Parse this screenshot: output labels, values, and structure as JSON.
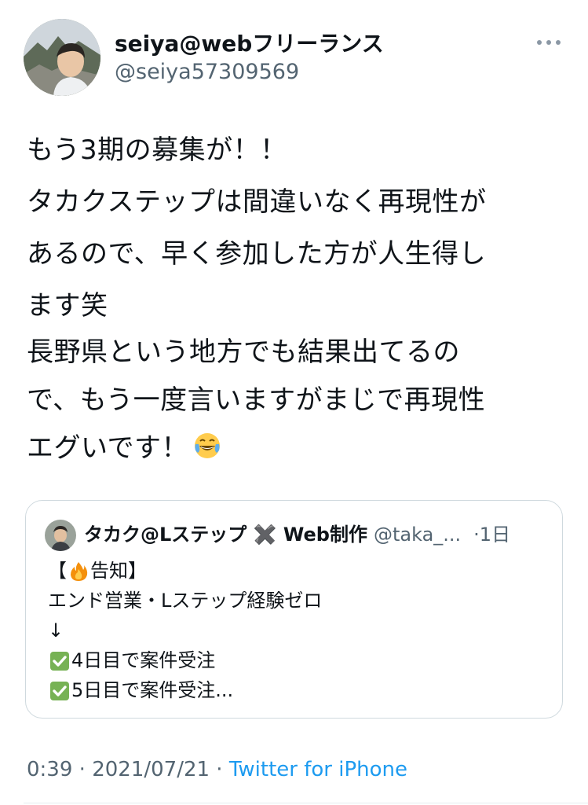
{
  "author": {
    "display_name": "seiya@webフリーランス",
    "handle": "@seiya57309569"
  },
  "tweet": {
    "paragraph1": "もう3期の募集が！！\nタカクステップは間違いなく再現性が\nあるので、早く参加した方が人生得し\nます笑",
    "paragraph2": "長野県という地方でも結果出てるの\nで、もう一度言いますがまじで再現性\nエグいです！",
    "emoji_icon": "face-with-tears-of-joy"
  },
  "quote": {
    "display_name": "タカク@Lステップ ✖️ Web制作",
    "handle": "@taka_...",
    "separator": "·",
    "time": "1日",
    "line1_prefix": "【",
    "line1_text": "告知】",
    "line2": "エンド営業・Lステップ経験ゼロ",
    "line3": "↓",
    "line4": "4日目で案件受注",
    "line5": "5日目で案件受注..."
  },
  "meta": {
    "time": "0:39",
    "sep1": " · ",
    "date": "2021/07/21",
    "sep2": " · ",
    "source": "Twitter for iPhone"
  },
  "colors": {
    "link": "#1d9bf0",
    "secondary_text": "#536471",
    "border": "#cfd9de"
  }
}
